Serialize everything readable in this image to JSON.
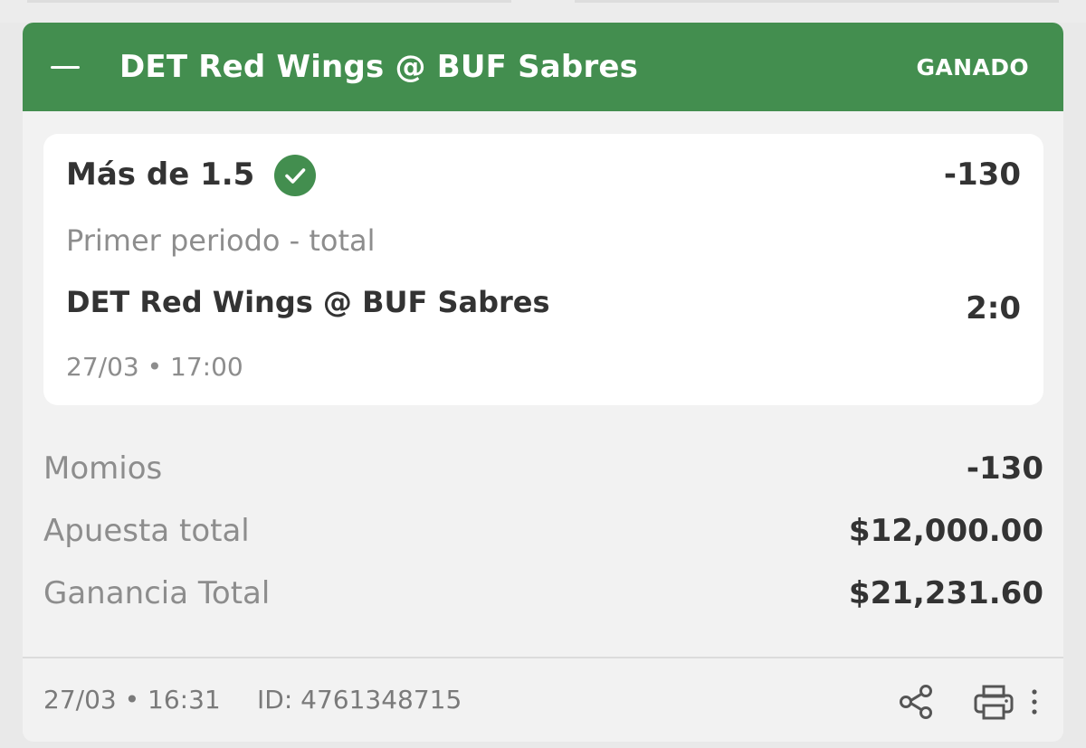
{
  "bet": {
    "header": {
      "title": "DET Red Wings @ BUF Sabres",
      "status": "GANADO",
      "color": "#438e4f"
    },
    "selection": {
      "market": "Más de 1.5",
      "odds": "-130",
      "type": "Primer periodo - total",
      "event": "DET Red Wings @ BUF Sabres",
      "score": "2:0",
      "datetime": "27/03 • 17:00",
      "status_icon": "check-circle-icon"
    },
    "summary": {
      "odds_label": "Momios",
      "odds_value": "-130",
      "stake_label": "Apuesta total",
      "stake_value": "$12,000.00",
      "payout_label": "Ganancia Total",
      "payout_value": "$21,231.60"
    },
    "footer": {
      "datetime": "27/03 • 16:31",
      "id": "ID: 4761348715",
      "icons": [
        "share-icon",
        "print-icon",
        "more-vertical-icon"
      ]
    }
  }
}
